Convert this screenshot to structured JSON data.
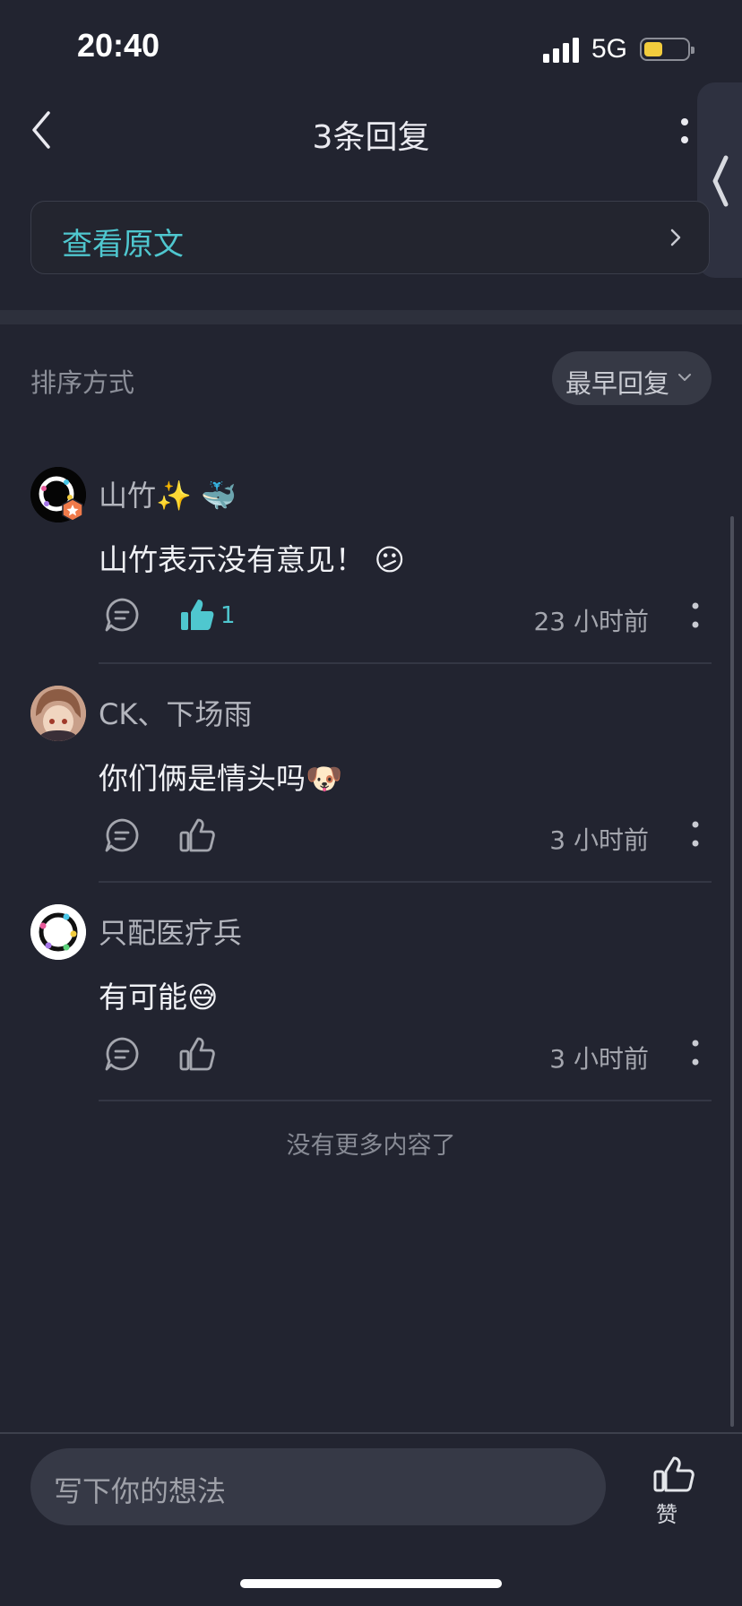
{
  "status_bar": {
    "time": "20:40",
    "network": "5G"
  },
  "header": {
    "title": "3条回复"
  },
  "view_original": {
    "label": "查看原文"
  },
  "sort": {
    "label": "排序方式",
    "selected": "最早回复"
  },
  "comments": [
    {
      "username": "山竹✨ 🐳",
      "content": "山竹表示没有意见！ 😕",
      "time": "23 小时前",
      "likes": "1",
      "liked": true
    },
    {
      "username": "CK、下场雨",
      "content": "你们俩是情头吗🐶",
      "time": "3 小时前",
      "likes": "",
      "liked": false
    },
    {
      "username": "只配医疗兵",
      "content": "有可能😅",
      "time": "3 小时前",
      "likes": "",
      "liked": false
    }
  ],
  "footer_note": "没有更多内容了",
  "bottom_bar": {
    "input_placeholder": "写下你的想法",
    "like_label": "赞"
  },
  "colors": {
    "background": "#222430",
    "accent": "#4fc7cf",
    "battery": "#f2cc3d"
  }
}
